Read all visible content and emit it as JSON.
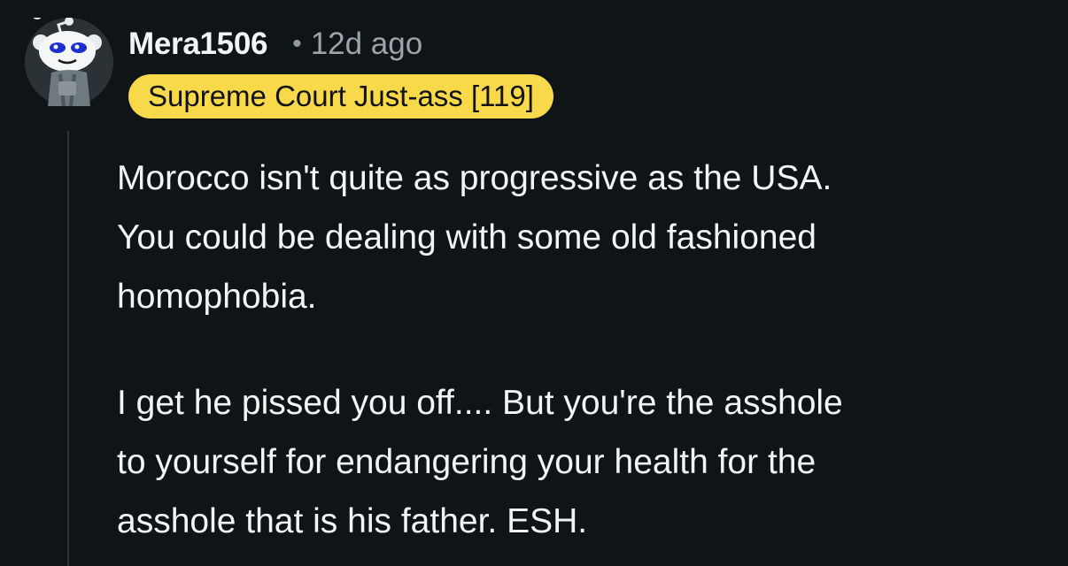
{
  "comment": {
    "author": "Mera1506",
    "separator": "•",
    "timestamp": "12d ago",
    "flair": "Supreme Court Just-ass [119]",
    "paragraphs": [
      "Morocco isn't quite as progressive as the USA.\nYou could be dealing with some old fashioned\nhomophobia.",
      "I get he pissed you off.... But you're the asshole\nto yourself for endangering your health for the\nasshole that is his father. ESH."
    ]
  },
  "colors": {
    "background": "#0f1416",
    "flair_background": "#f7d94a",
    "text": "#f2f4f5",
    "muted": "#9aa4aa"
  },
  "icons": {
    "avatar": "snoo-avatar-icon"
  }
}
